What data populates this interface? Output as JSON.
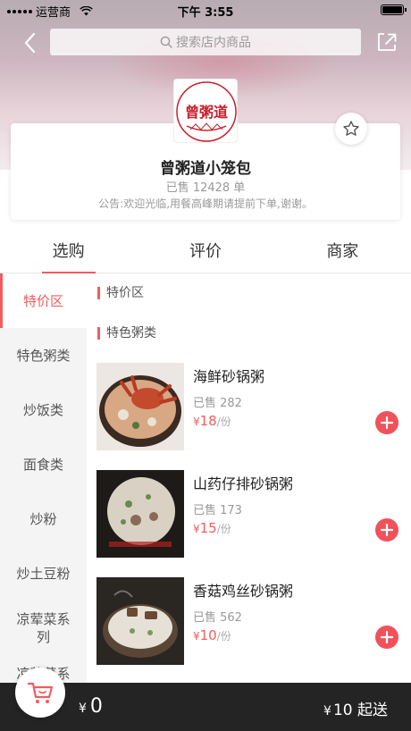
{
  "status_bar": {
    "carrier": "运营商",
    "time": "下午 3:55"
  },
  "search": {
    "placeholder": "搜索店内商品"
  },
  "shop": {
    "name": "曾粥道小笼包",
    "sold": "已售 12428 单",
    "notice": "公告:欢迎光临,用餐高峰期请提前下单,谢谢。",
    "logo_text": "曾粥道"
  },
  "tabs": [
    "选购",
    "评价",
    "商家"
  ],
  "sidebar": {
    "items": [
      "特价区",
      "特色粥类",
      "炒饭类",
      "面食类",
      "炒粉",
      "炒土豆粉",
      "凉荤菜系列",
      "凉荤菜系列"
    ]
  },
  "sections": [
    "特价区",
    "特色粥类"
  ],
  "items": [
    {
      "name": "海鲜砂锅粥",
      "sold": "已售 282",
      "currency": "¥",
      "price": "18",
      "unit": "/份"
    },
    {
      "name": "山药仔排砂锅粥",
      "sold": "已售 173",
      "currency": "¥",
      "price": "15",
      "unit": "/份"
    },
    {
      "name": "香菇鸡丝砂锅粥",
      "sold": "已售 562",
      "currency": "¥",
      "price": "10",
      "unit": "/份"
    }
  ],
  "cart": {
    "currency": "¥",
    "total": "0",
    "min_order": "10 起送"
  },
  "colors": {
    "accent": "#f15c5f",
    "bottom_bar": "#242424"
  },
  "icons": [
    "back-icon",
    "search-icon",
    "share-icon",
    "star-icon",
    "add-icon",
    "cart-icon"
  ]
}
